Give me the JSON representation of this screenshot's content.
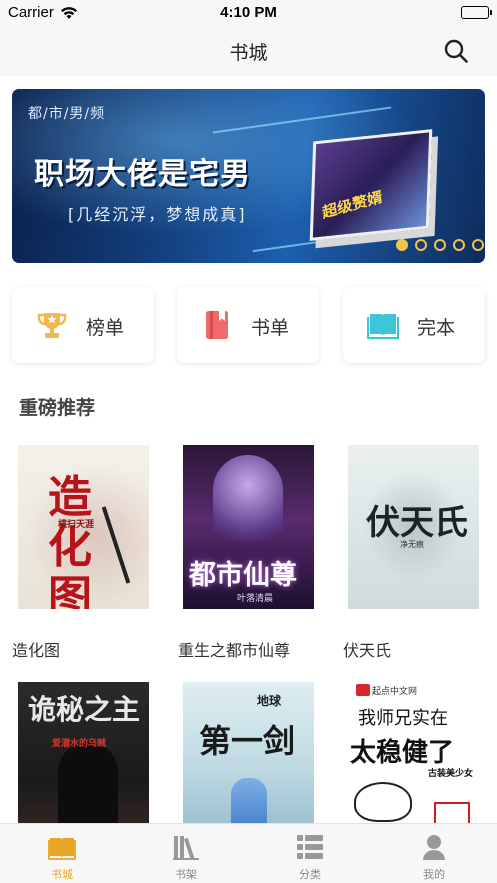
{
  "status_bar": {
    "carrier": "Carrier",
    "time": "4:10 PM"
  },
  "nav": {
    "title": "书城",
    "search_icon": "search-icon"
  },
  "banner": {
    "tag": "都/市/男/频",
    "title": "职场大佬是宅男",
    "subtitle": "[几经沉浮，梦想成真]",
    "book_title": "超级赘婿",
    "dots": 5,
    "active_dot": 0
  },
  "categories": [
    {
      "label": "榜单",
      "icon": "trophy-icon",
      "color": "#f2b84b"
    },
    {
      "label": "书单",
      "icon": "booklist-icon",
      "color": "#f06a6a"
    },
    {
      "label": "完本",
      "icon": "open-book-icon",
      "color": "#3cc4d8"
    }
  ],
  "section": {
    "title": "重磅推荐"
  },
  "books": [
    {
      "title": "造化图",
      "cover_text": "造化图",
      "cover_sub": "横扫天涯"
    },
    {
      "title": "重生之都市仙尊",
      "cover_text": "都市仙尊",
      "cover_sub": "叶落清晨"
    },
    {
      "title": "伏天氏",
      "cover_text": "伏天氏",
      "cover_sub": "净无痕"
    },
    {
      "title": "",
      "cover_text": "诡秘之主",
      "cover_sub": "爱潜水的乌贼"
    },
    {
      "title": "",
      "cover_text": "第一剑",
      "cover_sub": "地球"
    },
    {
      "title": "",
      "cover_text": "太稳健了",
      "cover_sub": "我师兄实在",
      "cover_brand": "起点中文网",
      "cover_extra": "古装美少女"
    }
  ],
  "tabs": [
    {
      "label": "书城",
      "icon": "bookstore-icon",
      "active": true
    },
    {
      "label": "书架",
      "icon": "bookshelf-icon",
      "active": false
    },
    {
      "label": "分类",
      "icon": "category-list-icon",
      "active": false
    },
    {
      "label": "我的",
      "icon": "profile-icon",
      "active": false
    }
  ],
  "colors": {
    "accent": "#e8a526",
    "dot": "#f2c14b"
  }
}
